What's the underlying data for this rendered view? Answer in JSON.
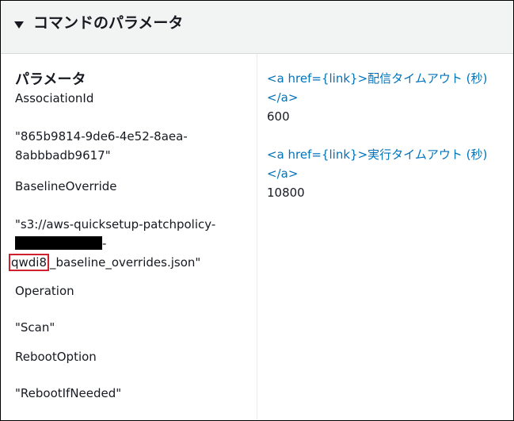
{
  "panel": {
    "title": "コマンドのパラメータ",
    "section_title": "パラメータ"
  },
  "parameters": [
    {
      "name": "AssociationId",
      "value_line1": "\"865b9814-9de6-4e52-8aea-",
      "value_line2": "8abbbadb9617\""
    },
    {
      "name": "BaselineOverride",
      "value_line1": "\"s3://aws-quicksetup-patchpolicy-",
      "value_line2_suffix": "-",
      "value_line3_highlight": "qwdi8",
      "value_line3_rest": "_baseline_overrides.json\""
    },
    {
      "name": "Operation",
      "value": "\"Scan\""
    },
    {
      "name": "RebootOption",
      "value": "\"RebootIfNeeded\""
    }
  ],
  "timeouts": [
    {
      "label_line1": "<a href={link}>配信タイムアウト (秒)",
      "label_line2": "</a>",
      "value": "600"
    },
    {
      "label_line1": "<a href={link}>実行タイムアウト (秒)",
      "label_line2": "</a>",
      "value": "10800"
    }
  ],
  "colors": {
    "header_bg": "#f2f3f3",
    "link": "#0073bb",
    "highlight_border": "#d0202e",
    "redaction": "#000000"
  }
}
